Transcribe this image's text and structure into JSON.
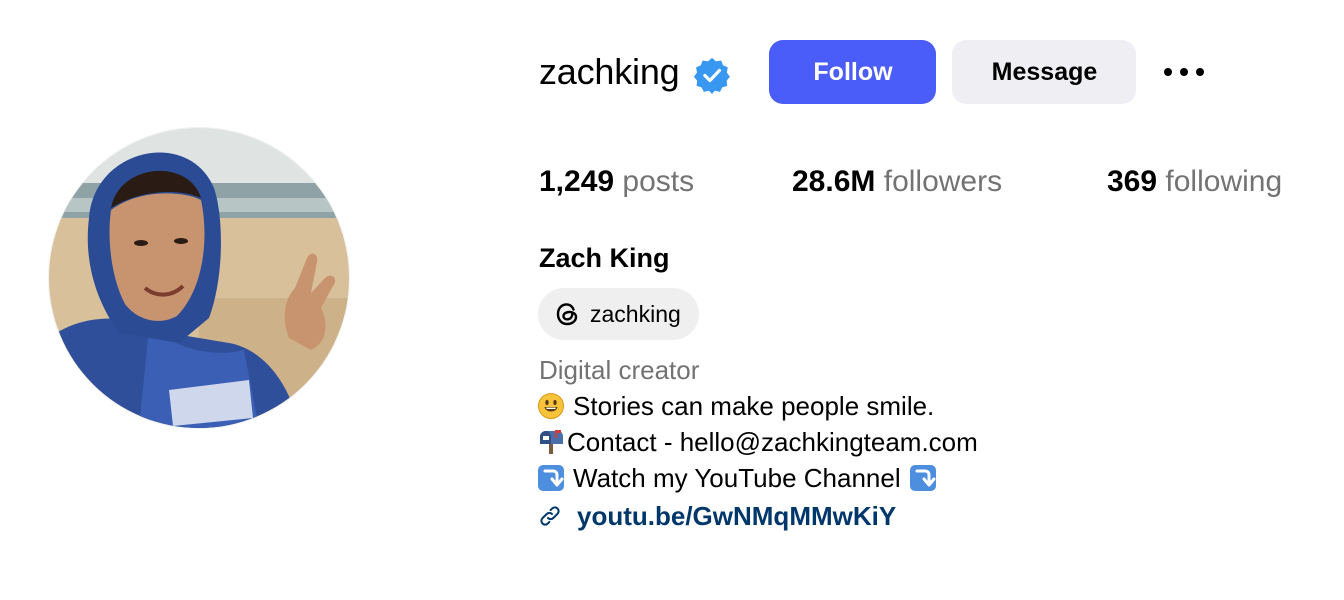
{
  "profile": {
    "username": "zachking",
    "verified": true,
    "full_name": "Zach King",
    "category": "Digital creator"
  },
  "actions": {
    "follow_label": "Follow",
    "message_label": "Message",
    "more_icon": "more-horizontal-icon"
  },
  "stats": {
    "posts": {
      "value": "1,249",
      "label": "posts"
    },
    "followers": {
      "value": "28.6M",
      "label": "followers"
    },
    "following": {
      "value": "369",
      "label": "following"
    }
  },
  "threads": {
    "icon": "threads-icon",
    "handle": "zachking"
  },
  "bio": {
    "line1": {
      "icon": "smiley-emoji",
      "text": "Stories can make people smile."
    },
    "line2": {
      "icon": "mailbox-emoji",
      "text": "Contact - hello@zachkingteam.com"
    },
    "line3": {
      "icon": "down-arrow-emoji",
      "text": "Watch my YouTube Channel",
      "trailing_icon": "down-arrow-emoji"
    }
  },
  "link": {
    "icon": "link-icon",
    "text": "youtu.be/GwNMqMMwKiY"
  },
  "colors": {
    "follow_bg": "#4a5df9",
    "message_bg": "#efeff3",
    "verified": "#3897f0",
    "secondary_text": "#737373",
    "link_text": "#00376b"
  }
}
